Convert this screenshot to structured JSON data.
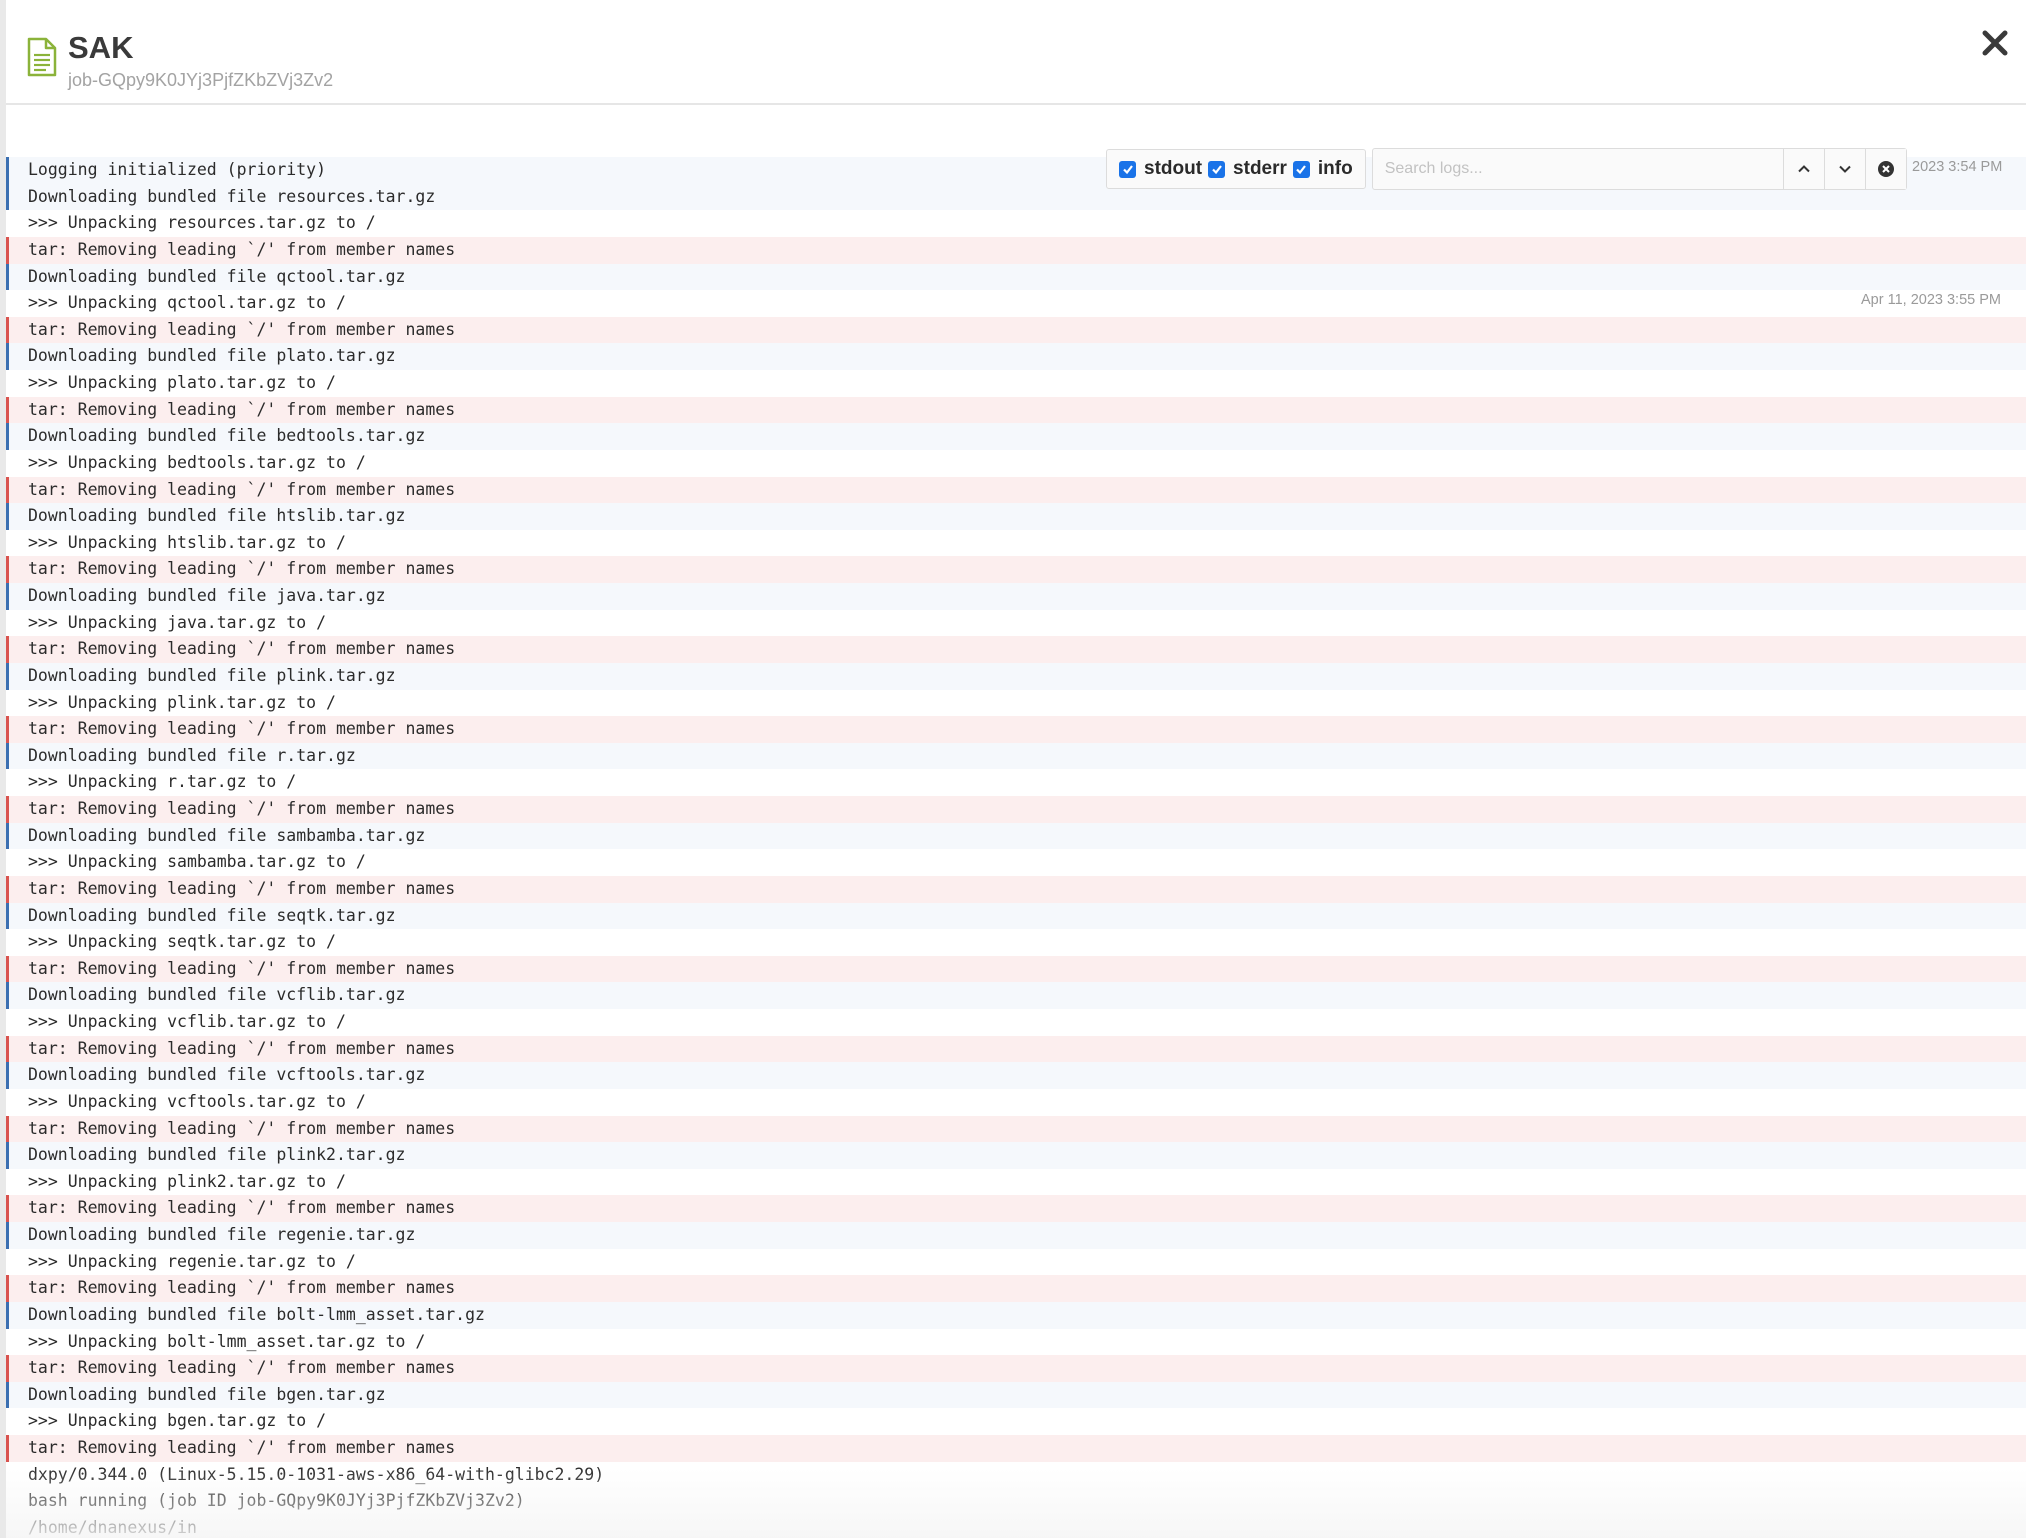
{
  "header": {
    "title": "SAK",
    "subtitle": "job-GQpy9K0JYj3PjfZKbZVj3Zv2"
  },
  "toolbar": {
    "filters": [
      {
        "label": "stdout",
        "checked": true
      },
      {
        "label": "stderr",
        "checked": true
      },
      {
        "label": "info",
        "checked": true
      }
    ],
    "search_placeholder": "Search logs..."
  },
  "timestamps": {
    "first": "2023 3:54 PM",
    "second": "Apr 11, 2023 3:55 PM"
  },
  "colors": {
    "info_border": "#3b6fb1",
    "stderr_border": "#d9534f",
    "stderr_bg": "#fceeee",
    "checkbox": "#1a73e8",
    "doc_icon": "#8bb33a"
  },
  "logs": [
    {
      "type": "info",
      "text": "Logging initialized (priority)"
    },
    {
      "type": "info",
      "text": "Downloading bundled file resources.tar.gz"
    },
    {
      "type": "stdout",
      "text": ">>> Unpacking resources.tar.gz to /"
    },
    {
      "type": "stderr",
      "text": "tar: Removing leading `/' from member names"
    },
    {
      "type": "info",
      "text": "Downloading bundled file qctool.tar.gz"
    },
    {
      "type": "stdout",
      "text": ">>> Unpacking qctool.tar.gz to /"
    },
    {
      "type": "stderr",
      "text": "tar: Removing leading `/' from member names"
    },
    {
      "type": "info",
      "text": "Downloading bundled file plato.tar.gz"
    },
    {
      "type": "stdout",
      "text": ">>> Unpacking plato.tar.gz to /"
    },
    {
      "type": "stderr",
      "text": "tar: Removing leading `/' from member names"
    },
    {
      "type": "info",
      "text": "Downloading bundled file bedtools.tar.gz"
    },
    {
      "type": "stdout",
      "text": ">>> Unpacking bedtools.tar.gz to /"
    },
    {
      "type": "stderr",
      "text": "tar: Removing leading `/' from member names"
    },
    {
      "type": "info",
      "text": "Downloading bundled file htslib.tar.gz"
    },
    {
      "type": "stdout",
      "text": ">>> Unpacking htslib.tar.gz to /"
    },
    {
      "type": "stderr",
      "text": "tar: Removing leading `/' from member names"
    },
    {
      "type": "info",
      "text": "Downloading bundled file java.tar.gz"
    },
    {
      "type": "stdout",
      "text": ">>> Unpacking java.tar.gz to /"
    },
    {
      "type": "stderr",
      "text": "tar: Removing leading `/' from member names"
    },
    {
      "type": "info",
      "text": "Downloading bundled file plink.tar.gz"
    },
    {
      "type": "stdout",
      "text": ">>> Unpacking plink.tar.gz to /"
    },
    {
      "type": "stderr",
      "text": "tar: Removing leading `/' from member names"
    },
    {
      "type": "info",
      "text": "Downloading bundled file r.tar.gz"
    },
    {
      "type": "stdout",
      "text": ">>> Unpacking r.tar.gz to /"
    },
    {
      "type": "stderr",
      "text": "tar: Removing leading `/' from member names"
    },
    {
      "type": "info",
      "text": "Downloading bundled file sambamba.tar.gz"
    },
    {
      "type": "stdout",
      "text": ">>> Unpacking sambamba.tar.gz to /"
    },
    {
      "type": "stderr",
      "text": "tar: Removing leading `/' from member names"
    },
    {
      "type": "info",
      "text": "Downloading bundled file seqtk.tar.gz"
    },
    {
      "type": "stdout",
      "text": ">>> Unpacking seqtk.tar.gz to /"
    },
    {
      "type": "stderr",
      "text": "tar: Removing leading `/' from member names"
    },
    {
      "type": "info",
      "text": "Downloading bundled file vcflib.tar.gz"
    },
    {
      "type": "stdout",
      "text": ">>> Unpacking vcflib.tar.gz to /"
    },
    {
      "type": "stderr",
      "text": "tar: Removing leading `/' from member names"
    },
    {
      "type": "info",
      "text": "Downloading bundled file vcftools.tar.gz"
    },
    {
      "type": "stdout",
      "text": ">>> Unpacking vcftools.tar.gz to /"
    },
    {
      "type": "stderr",
      "text": "tar: Removing leading `/' from member names"
    },
    {
      "type": "info",
      "text": "Downloading bundled file plink2.tar.gz"
    },
    {
      "type": "stdout",
      "text": ">>> Unpacking plink2.tar.gz to /"
    },
    {
      "type": "stderr",
      "text": "tar: Removing leading `/' from member names"
    },
    {
      "type": "info",
      "text": "Downloading bundled file regenie.tar.gz"
    },
    {
      "type": "stdout",
      "text": ">>> Unpacking regenie.tar.gz to /"
    },
    {
      "type": "stderr",
      "text": "tar: Removing leading `/' from member names"
    },
    {
      "type": "info",
      "text": "Downloading bundled file bolt-lmm_asset.tar.gz"
    },
    {
      "type": "stdout",
      "text": ">>> Unpacking bolt-lmm_asset.tar.gz to /"
    },
    {
      "type": "stderr",
      "text": "tar: Removing leading `/' from member names"
    },
    {
      "type": "info",
      "text": "Downloading bundled file bgen.tar.gz"
    },
    {
      "type": "stdout",
      "text": ">>> Unpacking bgen.tar.gz to /"
    },
    {
      "type": "stderr",
      "text": "tar: Removing leading `/' from member names"
    },
    {
      "type": "stdout",
      "text": "dxpy/0.344.0 (Linux-5.15.0-1031-aws-x86_64-with-glibc2.29)"
    },
    {
      "type": "stdout",
      "text": "bash running (job ID job-GQpy9K0JYj3PjfZKbZVj3Zv2)"
    },
    {
      "type": "stdout",
      "text": "/home/dnanexus/in"
    }
  ]
}
